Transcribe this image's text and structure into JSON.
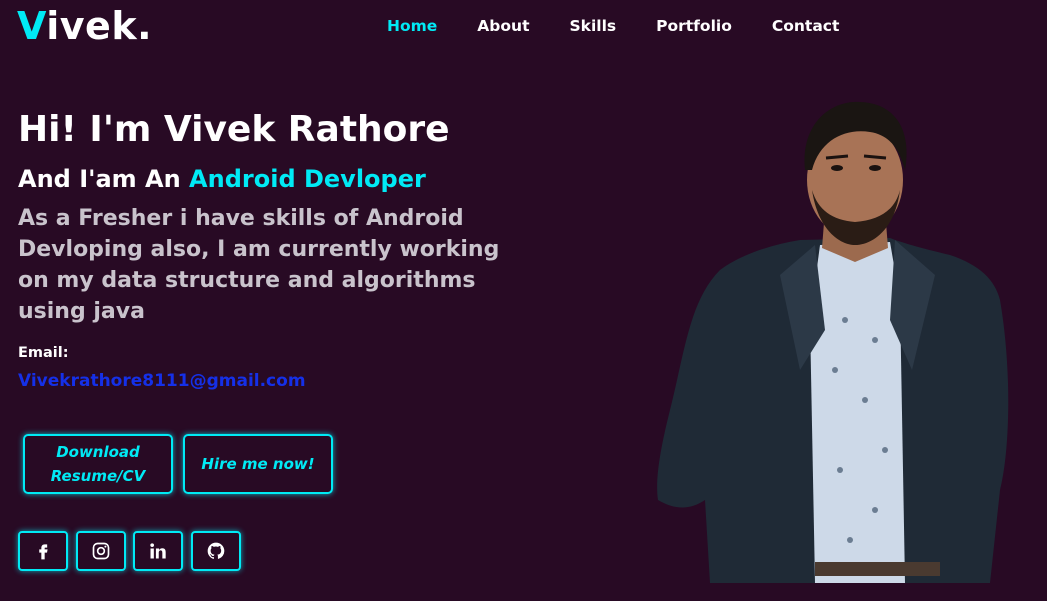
{
  "logo": {
    "accent": "V",
    "rest": "ivek."
  },
  "nav": {
    "items": [
      {
        "label": "Home",
        "active": true
      },
      {
        "label": "About"
      },
      {
        "label": "Skills"
      },
      {
        "label": "Portfolio"
      },
      {
        "label": "Contact"
      }
    ]
  },
  "hero": {
    "title": "Hi! I'm Vivek Rathore",
    "subtitle_prefix": "And I'am An ",
    "subtitle_role": "Android Devloper",
    "description": "As a Fresher i have skills of Android Devloping also, I am currently working on my data structure and algorithms using java",
    "email_label": "Email:",
    "email": "Vivekrathore8111@gmail.com"
  },
  "buttons": {
    "resume_line1": "Download",
    "resume_line2": "Resume/CV",
    "hire": "Hire me now!"
  },
  "socials": [
    "facebook-icon",
    "instagram-icon",
    "linkedin-icon",
    "github-icon"
  ],
  "colors": {
    "background": "#280a24",
    "accent": "#00eaf5",
    "email": "#1530e8",
    "description": "#c9c3cc"
  }
}
